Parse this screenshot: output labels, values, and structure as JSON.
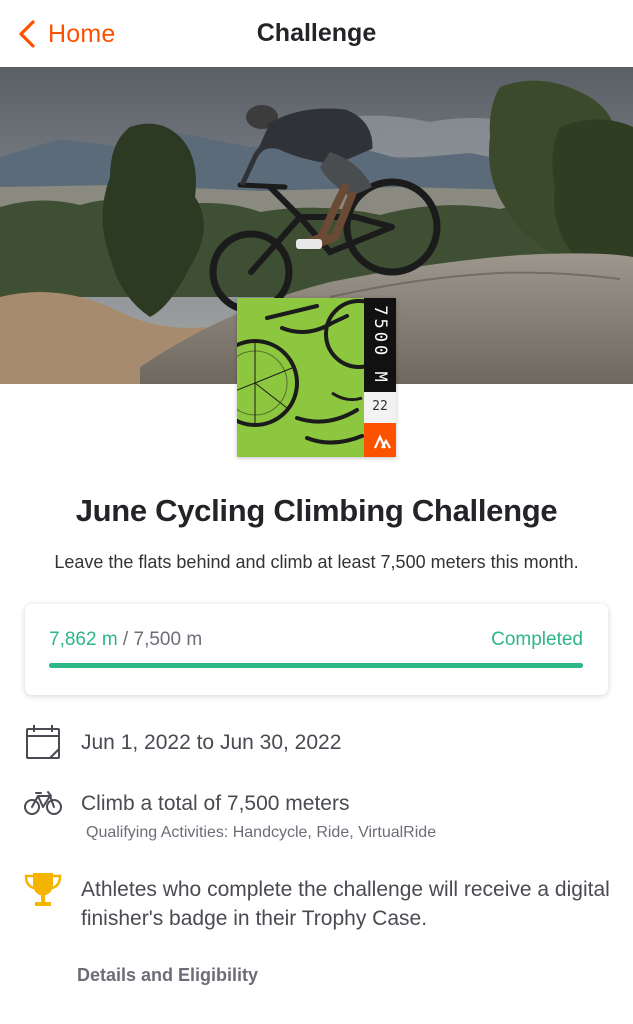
{
  "nav": {
    "back_label": "Home",
    "title": "Challenge"
  },
  "badge": {
    "goal_text": "7500 M",
    "year_text": "22",
    "background_color": "#8dc63f",
    "brand_color": "#fc5200"
  },
  "challenge": {
    "title": "June Cycling Climbing Challenge",
    "description": "Leave the flats behind and climb at least 7,500 meters this month."
  },
  "progress": {
    "current": "7,862 m",
    "separator": " / ",
    "goal": "7,500 m",
    "status": "Completed",
    "fraction": 1.0,
    "color": "#2cb785"
  },
  "info": {
    "dates": "Jun 1, 2022 to Jun 30, 2022",
    "goal": "Climb a total of 7,500 meters",
    "qualifying": "Qualifying Activities: Handcycle, Ride, VirtualRide",
    "reward": "Athletes who complete the challenge will receive a digital finisher's badge in their Trophy Case."
  },
  "details_link": "Details and Eligibility",
  "icons": {
    "back": "chevron-left-icon",
    "calendar": "calendar-icon",
    "bike": "bicycle-icon",
    "trophy": "trophy-icon",
    "brand": "strava-logo-icon"
  }
}
